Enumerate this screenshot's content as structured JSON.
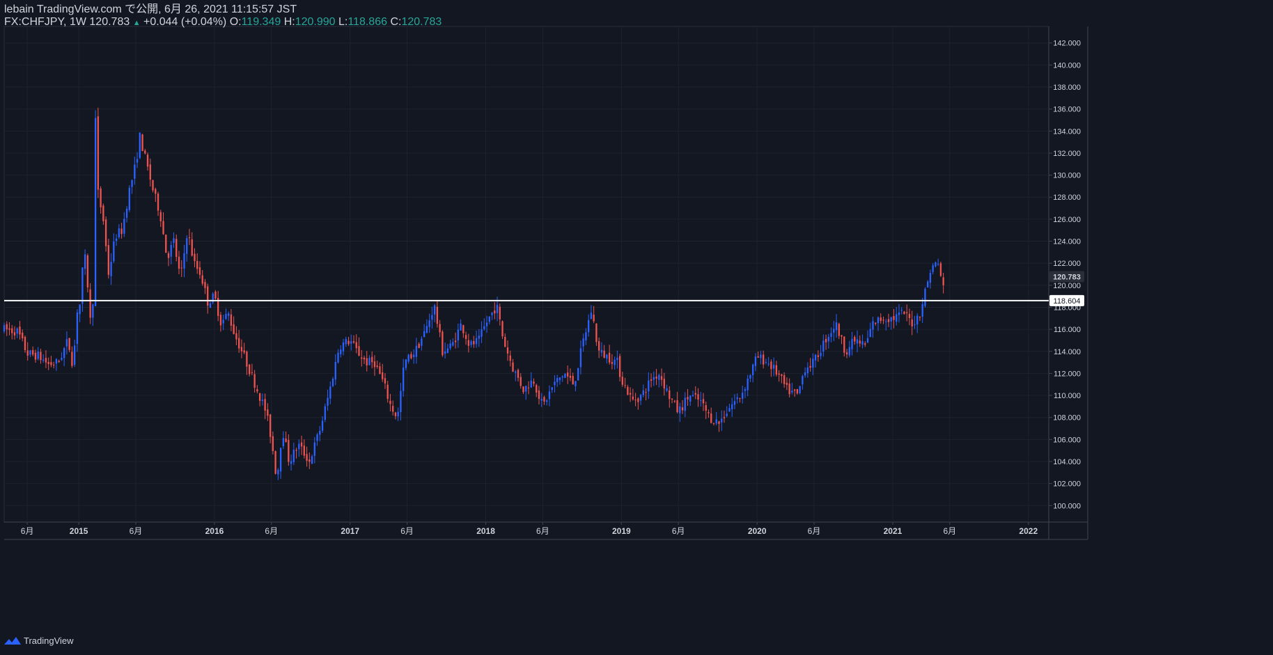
{
  "header": {
    "publish_line": "lebain TradingView.com で公開, 6月 26, 2021 11:15:57 JST",
    "symbol": "FX:CHFJPY, 1W",
    "last": "120.783",
    "change": "+0.044 (+0.04%)",
    "o_label": "O:",
    "o_value": "119.349",
    "h_label": "H:",
    "h_value": "120.990",
    "l_label": "L:",
    "l_value": "118.866",
    "c_label": "C:",
    "c_value": "120.783",
    "up_icon": "triangle-up-icon"
  },
  "footer": {
    "brand": "TradingView",
    "logo_icon": "tradingview-logo-icon"
  },
  "colors": {
    "background": "#131722",
    "up": "#2962ff",
    "down": "#ef5350",
    "grid": "#1e222d",
    "axis_text": "#d1d4dc",
    "hline": "#ffffff",
    "pos_text": "#26a69a"
  },
  "chart_data": {
    "type": "candlestick",
    "title": "",
    "symbol": "FX:CHFJPY",
    "interval": "1W",
    "ylim": [
      98.5,
      143.5
    ],
    "xlim": [
      2014.45,
      2022.15
    ],
    "y_ticks": [
      "100.000",
      "102.000",
      "104.000",
      "106.000",
      "108.000",
      "110.000",
      "112.000",
      "114.000",
      "116.000",
      "118.000",
      "120.000",
      "122.000",
      "124.000",
      "126.000",
      "128.000",
      "130.000",
      "132.000",
      "134.000",
      "136.000",
      "138.000",
      "140.000",
      "142.000"
    ],
    "x_ticks": [
      {
        "t": 2014.62,
        "label": "6月"
      },
      {
        "t": 2015.0,
        "label": "2015"
      },
      {
        "t": 2015.42,
        "label": "6月"
      },
      {
        "t": 2016.0,
        "label": "2016"
      },
      {
        "t": 2016.42,
        "label": "6月"
      },
      {
        "t": 2017.0,
        "label": "2017"
      },
      {
        "t": 2017.42,
        "label": "6月"
      },
      {
        "t": 2018.0,
        "label": "2018"
      },
      {
        "t": 2018.42,
        "label": "6月"
      },
      {
        "t": 2019.0,
        "label": "2019"
      },
      {
        "t": 2019.42,
        "label": "6月"
      },
      {
        "t": 2020.0,
        "label": "2020"
      },
      {
        "t": 2020.42,
        "label": "6月"
      },
      {
        "t": 2021.0,
        "label": "2021"
      },
      {
        "t": 2021.42,
        "label": "6月"
      },
      {
        "t": 2022.0,
        "label": "2022"
      }
    ],
    "price_labels": [
      {
        "value": 120.783,
        "label": "120.783",
        "kind": "last"
      },
      {
        "value": 118.604,
        "label": "118.604",
        "kind": "hline"
      }
    ],
    "horizontal_line": 118.604,
    "path": [
      [
        2014.45,
        116.0
      ],
      [
        2014.55,
        115.8
      ],
      [
        2014.62,
        113.8
      ],
      [
        2014.7,
        113.6
      ],
      [
        2014.78,
        112.8
      ],
      [
        2014.85,
        113.0
      ],
      [
        2014.92,
        115.0
      ],
      [
        2014.96,
        112.5
      ],
      [
        2014.985,
        118.0
      ],
      [
        2015.0,
        117.0
      ],
      [
        2015.02,
        120.3
      ],
      [
        2015.04,
        123.0
      ],
      [
        2015.06,
        121.0
      ],
      [
        2015.08,
        117.5
      ],
      [
        2015.1,
        114.5
      ],
      [
        2015.12,
        136.2
      ],
      [
        2015.14,
        128.5
      ],
      [
        2015.18,
        126.0
      ],
      [
        2015.22,
        121.0
      ],
      [
        2015.27,
        124.5
      ],
      [
        2015.32,
        125.0
      ],
      [
        2015.37,
        128.5
      ],
      [
        2015.42,
        131.0
      ],
      [
        2015.45,
        133.5
      ],
      [
        2015.5,
        131.0
      ],
      [
        2015.55,
        128.5
      ],
      [
        2015.6,
        126.5
      ],
      [
        2015.65,
        122.5
      ],
      [
        2015.7,
        124.0
      ],
      [
        2015.75,
        120.5
      ],
      [
        2015.8,
        125.0
      ],
      [
        2015.85,
        122.0
      ],
      [
        2015.9,
        121.0
      ],
      [
        2015.95,
        118.5
      ],
      [
        2016.0,
        119.0
      ],
      [
        2016.05,
        116.5
      ],
      [
        2016.1,
        117.5
      ],
      [
        2016.15,
        115.5
      ],
      [
        2016.22,
        113.5
      ],
      [
        2016.3,
        111.0
      ],
      [
        2016.38,
        108.5
      ],
      [
        2016.42,
        106.0
      ],
      [
        2016.46,
        102.3
      ],
      [
        2016.5,
        107.0
      ],
      [
        2016.55,
        104.0
      ],
      [
        2016.62,
        105.5
      ],
      [
        2016.7,
        104.0
      ],
      [
        2016.78,
        107.0
      ],
      [
        2016.85,
        110.5
      ],
      [
        2016.92,
        114.5
      ],
      [
        2017.0,
        115.0
      ],
      [
        2017.05,
        114.0
      ],
      [
        2017.12,
        113.0
      ],
      [
        2017.18,
        113.0
      ],
      [
        2017.25,
        111.0
      ],
      [
        2017.3,
        109.0
      ],
      [
        2017.35,
        108.0
      ],
      [
        2017.4,
        113.0
      ],
      [
        2017.48,
        114.0
      ],
      [
        2017.52,
        115.0
      ],
      [
        2017.56,
        116.0
      ],
      [
        2017.62,
        118.2
      ],
      [
        2017.68,
        114.0
      ],
      [
        2017.75,
        114.5
      ],
      [
        2017.82,
        116.5
      ],
      [
        2017.88,
        114.5
      ],
      [
        2017.95,
        115.0
      ],
      [
        2018.0,
        116.5
      ],
      [
        2018.08,
        118.2
      ],
      [
        2018.13,
        115.0
      ],
      [
        2018.2,
        112.5
      ],
      [
        2018.28,
        110.5
      ],
      [
        2018.35,
        111.5
      ],
      [
        2018.42,
        109.0
      ],
      [
        2018.5,
        111.0
      ],
      [
        2018.58,
        112.0
      ],
      [
        2018.65,
        111.0
      ],
      [
        2018.72,
        115.0
      ],
      [
        2018.78,
        117.8
      ],
      [
        2018.83,
        114.0
      ],
      [
        2018.9,
        113.5
      ],
      [
        2018.97,
        113.0
      ],
      [
        2019.0,
        111.5
      ],
      [
        2019.08,
        109.5
      ],
      [
        2019.15,
        110.0
      ],
      [
        2019.22,
        111.5
      ],
      [
        2019.28,
        112.0
      ],
      [
        2019.35,
        110.0
      ],
      [
        2019.42,
        108.5
      ],
      [
        2019.5,
        110.0
      ],
      [
        2019.58,
        109.5
      ],
      [
        2019.65,
        108.0
      ],
      [
        2019.72,
        107.5
      ],
      [
        2019.8,
        109.0
      ],
      [
        2019.88,
        110.0
      ],
      [
        2019.95,
        112.0
      ],
      [
        2020.0,
        113.5
      ],
      [
        2020.08,
        113.0
      ],
      [
        2020.15,
        112.0
      ],
      [
        2020.22,
        110.5
      ],
      [
        2020.3,
        110.0
      ],
      [
        2020.35,
        112.5
      ],
      [
        2020.42,
        113.0
      ],
      [
        2020.5,
        115.0
      ],
      [
        2020.58,
        116.5
      ],
      [
        2020.65,
        114.0
      ],
      [
        2020.72,
        115.0
      ],
      [
        2020.8,
        114.5
      ],
      [
        2020.85,
        116.5
      ],
      [
        2020.92,
        117.0
      ],
      [
        2021.0,
        117.0
      ],
      [
        2021.08,
        117.5
      ],
      [
        2021.15,
        116.5
      ],
      [
        2021.2,
        117.5
      ],
      [
        2021.24,
        119.5
      ],
      [
        2021.28,
        121.5
      ],
      [
        2021.32,
        122.0
      ],
      [
        2021.345,
        121.8
      ],
      [
        2021.37,
        119.3
      ],
      [
        2021.38,
        120.8
      ]
    ]
  }
}
